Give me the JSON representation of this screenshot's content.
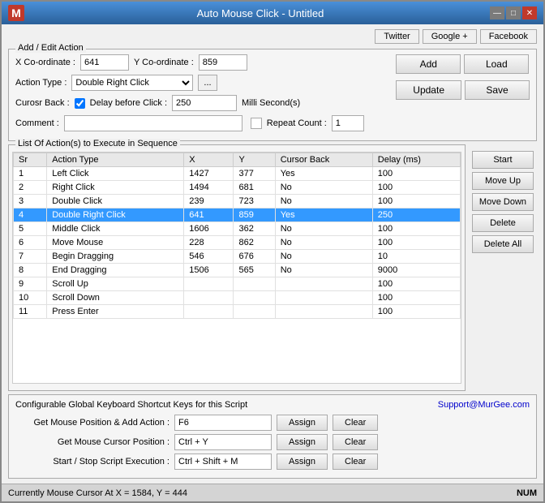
{
  "window": {
    "icon": "M",
    "title": "Auto Mouse Click - Untitled",
    "controls": {
      "minimize": "—",
      "maximize": "□",
      "close": "✕"
    }
  },
  "social_buttons": {
    "twitter": "Twitter",
    "google_plus": "Google +",
    "facebook": "Facebook"
  },
  "form": {
    "section_label": "Add / Edit Action",
    "x_coord_label": "X Co-ordinate :",
    "x_coord_value": "641",
    "y_coord_label": "Y Co-ordinate :",
    "y_coord_value": "859",
    "action_type_label": "Action Type :",
    "action_type_value": "Double Right Click",
    "cursor_back_label": "Curosr Back :",
    "delay_label": "Delay before Click :",
    "delay_value": "250",
    "delay_unit": "Milli Second(s)",
    "comment_label": "Comment :",
    "repeat_count_label": "Repeat Count :",
    "repeat_count_value": "1",
    "add_btn": "Add",
    "load_btn": "Load",
    "update_btn": "Update",
    "save_btn": "Save",
    "dots_btn": "..."
  },
  "table": {
    "section_label": "List Of Action(s) to Execute in Sequence",
    "columns": [
      "Sr",
      "Action Type",
      "X",
      "Y",
      "Cursor Back",
      "Delay (ms)"
    ],
    "rows": [
      {
        "sr": "1",
        "action": "Left Click",
        "x": "1427",
        "y": "377",
        "cursor_back": "Yes",
        "delay": "100",
        "selected": false
      },
      {
        "sr": "2",
        "action": "Right Click",
        "x": "1494",
        "y": "681",
        "cursor_back": "No",
        "delay": "100",
        "selected": false
      },
      {
        "sr": "3",
        "action": "Double Click",
        "x": "239",
        "y": "723",
        "cursor_back": "No",
        "delay": "100",
        "selected": false
      },
      {
        "sr": "4",
        "action": "Double Right Click",
        "x": "641",
        "y": "859",
        "cursor_back": "Yes",
        "delay": "250",
        "selected": true
      },
      {
        "sr": "5",
        "action": "Middle Click",
        "x": "1606",
        "y": "362",
        "cursor_back": "No",
        "delay": "100",
        "selected": false
      },
      {
        "sr": "6",
        "action": "Move Mouse",
        "x": "228",
        "y": "862",
        "cursor_back": "No",
        "delay": "100",
        "selected": false
      },
      {
        "sr": "7",
        "action": "Begin Dragging",
        "x": "546",
        "y": "676",
        "cursor_back": "No",
        "delay": "10",
        "selected": false
      },
      {
        "sr": "8",
        "action": "End Dragging",
        "x": "1506",
        "y": "565",
        "cursor_back": "No",
        "delay": "9000",
        "selected": false
      },
      {
        "sr": "9",
        "action": "Scroll Up",
        "x": "",
        "y": "",
        "cursor_back": "",
        "delay": "100",
        "selected": false
      },
      {
        "sr": "10",
        "action": "Scroll Down",
        "x": "",
        "y": "",
        "cursor_back": "",
        "delay": "100",
        "selected": false
      },
      {
        "sr": "11",
        "action": "Press Enter",
        "x": "",
        "y": "",
        "cursor_back": "",
        "delay": "100",
        "selected": false
      }
    ],
    "start_btn": "Start",
    "move_up_btn": "Move Up",
    "move_down_btn": "Move Down",
    "delete_btn": "Delete",
    "delete_all_btn": "Delete All"
  },
  "shortcuts": {
    "section_label": "Configurable Global Keyboard Shortcut Keys for this Script",
    "support_link": "Support@MurGee.com",
    "rows": [
      {
        "label": "Get Mouse Position & Add Action :",
        "value": "F6",
        "assign_btn": "Assign",
        "clear_btn": "Clear"
      },
      {
        "label": "Get Mouse Cursor Position :",
        "value": "Ctrl + Y",
        "assign_btn": "Assign",
        "clear_btn": "Clear"
      },
      {
        "label": "Start / Stop Script Execution :",
        "value": "Ctrl + Shift + M",
        "assign_btn": "Assign",
        "clear_btn": "Clear"
      }
    ]
  },
  "status_bar": {
    "text": "Currently Mouse Cursor At X = 1584, Y = 444",
    "num_indicator": "NUM"
  }
}
